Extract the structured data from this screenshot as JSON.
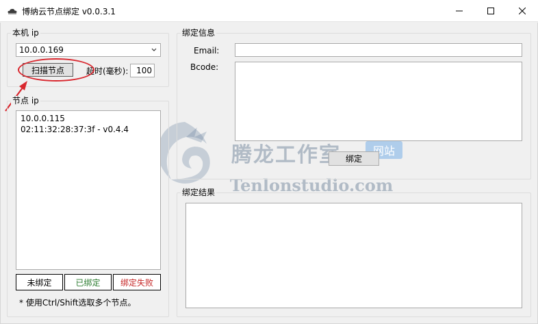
{
  "window": {
    "title": "博纳云节点绑定 v0.0.3.1"
  },
  "local_ip": {
    "group_title": "本机 ip",
    "selected_ip": "10.0.0.169",
    "scan_button": "扫描节点",
    "timeout_label": "超时(毫秒):",
    "timeout_value": "100"
  },
  "node_ip": {
    "group_title": "节点 ip",
    "items": [
      "10.0.0.115",
      "02:11:32:28:37:3f - v0.4.4"
    ],
    "legend": {
      "unbound": "未绑定",
      "bound": "已绑定",
      "failed": "绑定失败"
    },
    "hint": "* 使用Ctrl/Shift选取多个节点。"
  },
  "bind_info": {
    "group_title": "绑定信息",
    "email_label": "Email:",
    "email_value": "",
    "bcode_label": "Bcode:",
    "bcode_value": "",
    "bind_button": "绑定"
  },
  "bind_result": {
    "group_title": "绑定结果",
    "value": ""
  },
  "watermark": {
    "cn": "腾龙工作室",
    "badge": "网站",
    "en": "Tenlonstudio.com"
  },
  "colors": {
    "bound": "#2e7d32",
    "failed": "#c62828",
    "annotation": "#d9272e"
  }
}
